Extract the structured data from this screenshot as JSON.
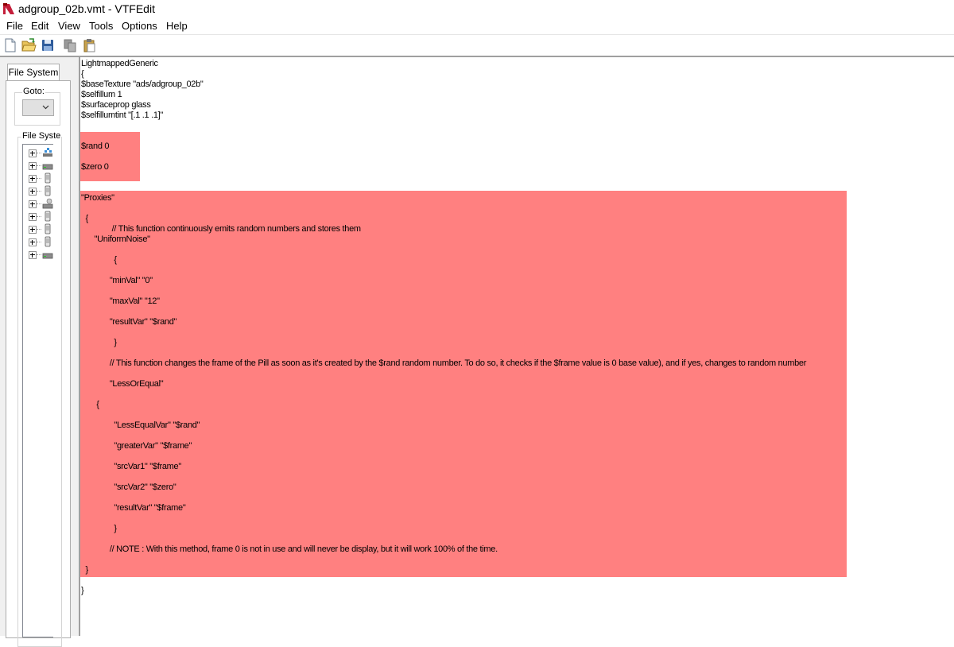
{
  "window": {
    "title": "adgroup_02b.vmt - VTFEdit"
  },
  "menu": [
    "File",
    "Edit",
    "View",
    "Tools",
    "Options",
    "Help"
  ],
  "toolbar": {
    "icons": [
      "new-file-icon",
      "open-folder-icon",
      "save-icon",
      "copy-icon",
      "paste-icon"
    ]
  },
  "sidebar": {
    "tab_label": "File System",
    "goto_label": "Goto:",
    "goto_value": "",
    "tree_label": "File System",
    "tree_items": [
      {
        "icon": "network-drive-icon"
      },
      {
        "icon": "drive-icon"
      },
      {
        "icon": "removable-drive-icon"
      },
      {
        "icon": "removable-drive-icon"
      },
      {
        "icon": "cd-drive-icon"
      },
      {
        "icon": "removable-drive-icon"
      },
      {
        "icon": "removable-drive-icon"
      },
      {
        "icon": "removable-drive-icon"
      },
      {
        "icon": "drive-icon"
      }
    ]
  },
  "editor": {
    "highlight_color": "#ff8080",
    "lines": [
      "LightmappedGeneric",
      "{",
      "$baseTexture \"ads/adgroup_02b\"",
      "$selfillum 1",
      "$surfaceprop glass",
      "$selfillumtint \"[.1 .1 .1]\"",
      "$rand 0",
      "$zero 0",
      "\"Proxies\"",
      "  {",
      "              // This function continuously emits random numbers and stores them",
      "      \"UniformNoise\"",
      "               {",
      "             \"minVal\" \"0\"",
      "             \"maxVal\" \"12\"",
      "             \"resultVar\" \"$rand\"",
      "               }",
      "             // This function changes the frame of the Pill as soon as it's created by the $rand random number. To do so, it checks if the $frame value is 0 base value), and if yes, changes to random number",
      "             \"LessOrEqual\"",
      "       {",
      "               \"LessEqualVar\" \"$rand\"",
      "               \"greaterVar\" \"$frame\"",
      "               \"srcVar1\" \"$frame\"",
      "               \"srcVar2\" \"$zero\"",
      "               \"resultVar\" \"$frame\"",
      "               }",
      "             // NOTE : With this method, frame 0 is not in use and will never be display, but it will work 100% of the time.",
      "  }",
      "}"
    ]
  }
}
